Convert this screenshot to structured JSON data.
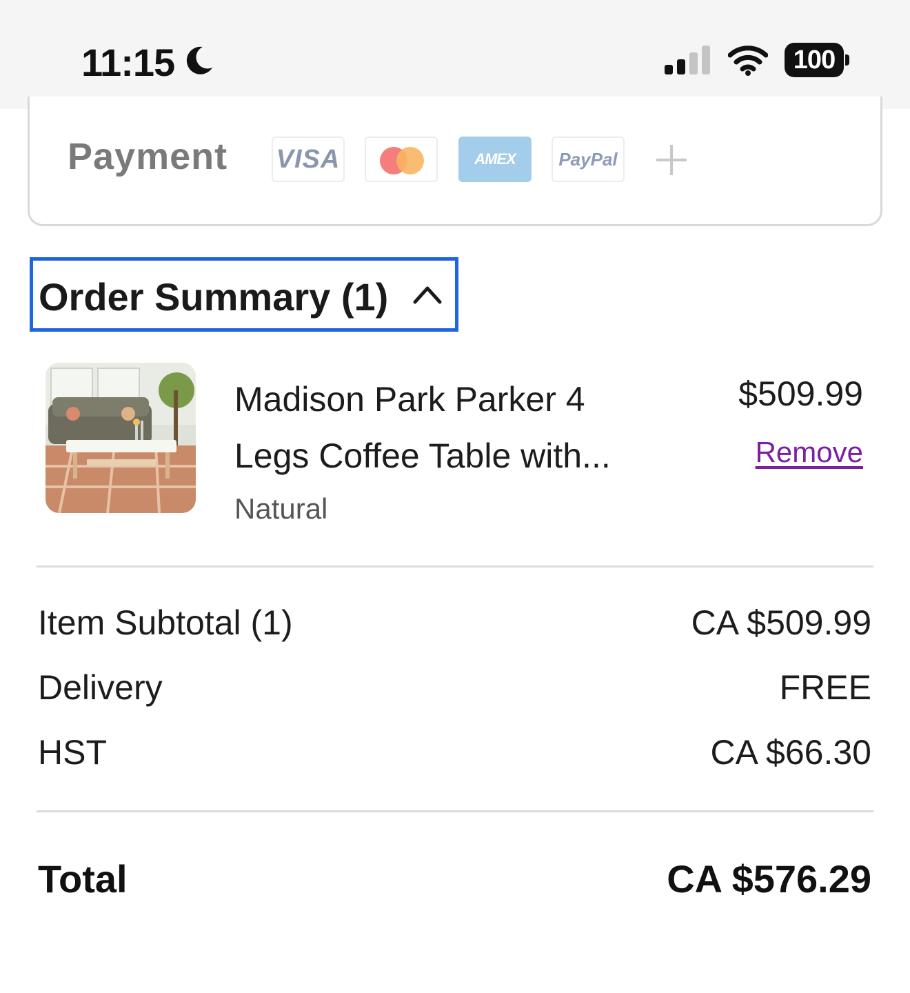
{
  "status_bar": {
    "time": "11:15",
    "battery": "100"
  },
  "payment": {
    "label": "Payment",
    "methods": [
      "VISA",
      "AMEX",
      "PayPal"
    ]
  },
  "order_summary": {
    "title": "Order Summary (1)"
  },
  "item": {
    "name": "Madison Park Parker 4 Legs Coffee Table with...",
    "variant": "Natural",
    "price": "$509.99",
    "remove_label": "Remove"
  },
  "totals": {
    "subtotal_label": "Item Subtotal (1)",
    "subtotal_value": "CA $509.99",
    "delivery_label": "Delivery",
    "delivery_value": "FREE",
    "tax_label": "HST",
    "tax_value": "CA $66.30",
    "total_label": "Total",
    "total_value": "CA $576.29"
  },
  "colors": {
    "focus_border": "#1e64e0",
    "remove_link": "#7a1fa2",
    "amex_bg": "#a3cdea"
  }
}
